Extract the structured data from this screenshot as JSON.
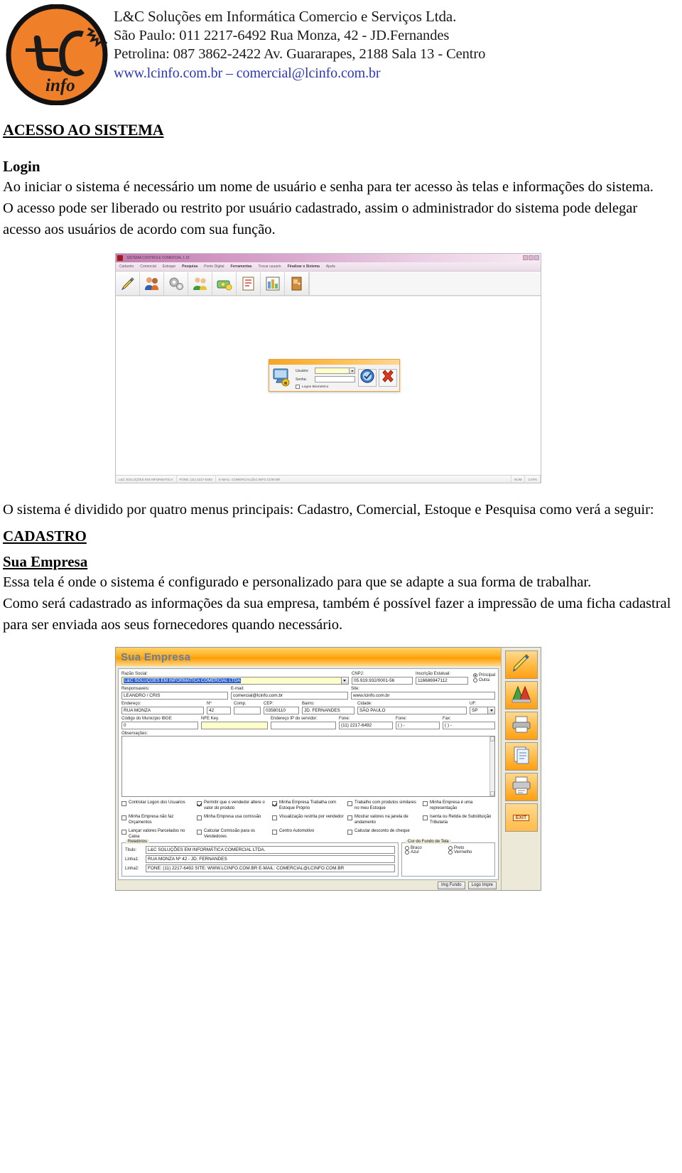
{
  "letterhead": {
    "logo_alt": "lc-info-logo",
    "logo_text_top": "L C",
    "logo_text_bottom": "info",
    "lines": [
      "L&C Soluções em Informática Comercio e Serviços Ltda.",
      "São Paulo: 011 2217-6492 Rua Monza, 42  -  JD.Fernandes",
      "Petrolina:   087 3862-2422 Av. Guararapes, 2188 Sala 13 - Centro"
    ],
    "url_line": "www.lcinfo.com.br – comercial@lcinfo.com.br"
  },
  "doc": {
    "section_title": "ACESSO AO SISTEMA",
    "login_heading": "Login",
    "login_p1": "Ao iniciar o sistema é necessário um nome de usuário e senha para ter acesso às telas e informações do sistema.",
    "login_p2": "O acesso pode ser liberado ou restrito por usuário cadastrado, assim o administrador do sistema pode delegar acesso aos usuários de acordo com sua função.",
    "menus_p": "O sistema é dividido por quatro menus principais: Cadastro, Comercial, Estoque e Pesquisa como verá a seguir:",
    "cadastro_title": "CADASTRO",
    "empresa_title": "Sua Empresa",
    "empresa_p1": "Essa tela é onde o sistema é configurado e personalizado para que se adapte a sua forma de trabalhar.",
    "empresa_p2": "Como será cadastrado as informações da sua empresa, também é possível fazer a impressão de uma ficha cadastral para ser enviada aos seus fornecedores quando necessário."
  },
  "screenshot_login": {
    "window_title": "SISTEMA CONTROLE COMERCIAL 1.19",
    "menus": [
      "Cadastro",
      "Comercial",
      "Estoque",
      "Pesquisa",
      "Ponto Digital",
      "Ferramentas",
      "Trocar usuario",
      "Finalizar o Sistema",
      "Ajuda"
    ],
    "toolbar_icons": [
      "pen-tool-icon",
      "users-icon",
      "gears-icon",
      "people-icon",
      "money-icon",
      "note-icon",
      "report-icon",
      "door-exit-icon"
    ],
    "dialog": {
      "user_label": "Usuário:",
      "user_value": "",
      "password_label": "Senha:",
      "password_value": "",
      "biometric_label": "Logon Biometrico",
      "ok_icon": "check-circle-icon",
      "cancel_icon": "red-x-icon"
    },
    "status_bar": [
      "L&C SOLUÇÕES EM INFORMATICA",
      "FONE: (11) 2217-6492",
      "E-MAIL: COMERCIAL@LCINFO.COM.BR",
      "NUM",
      "CAPS"
    ]
  },
  "screenshot_empresa": {
    "title": "Sua Empresa",
    "fields": {
      "razao_social_label": "Razão Social:",
      "razao_social_value": "L&C SOLUÇOES EM INFORMATICA COMERCIAL LTDA",
      "cnpj_label": "CNPJ:",
      "cnpj_value": "05.919.932/0001-56",
      "inscricao_label": "Inscrição Estatual:",
      "inscricao_value": "116686947112",
      "radio_principal": "Principal",
      "radio_outra": "Outra",
      "responsaveis_label": "Responsaveis:",
      "responsaveis_value": "LEANDRO / CRIS",
      "email_label": "E-mail:",
      "email_value": "comercial@lcinfo.com.br",
      "site_label": "Site:",
      "site_value": "www.lcinfo.com.br",
      "endereco_label": "Endereço:",
      "endereco_value": "RUA MONZA",
      "numero_label": "Nº",
      "numero_value": "42",
      "comp_label": "Comp.",
      "comp_value": "",
      "cep_label": "CEP:",
      "cep_value": "03580110",
      "bairro_label": "Bairro:",
      "bairro_value": "JD. FERNANDES",
      "cidade_label": "Cidade:",
      "cidade_value": "SÃO PAULO",
      "uf_label": "UF:",
      "uf_value": "SP",
      "municipio_label": "Código do Município IBGE",
      "municipio_value": "0",
      "nfe_label": "NFE Key.",
      "nfe_value": "",
      "ip_label": "Endereço IP do servidor:",
      "ip_value": "",
      "fone_label": "Fone:",
      "fone_value": "(11) 2217-6492",
      "fone2_label": "Fone:",
      "fone2_value": "(  )   -",
      "fax_label": "Fax:",
      "fax_value": "(  )   -",
      "obs_label": "Observações:",
      "obs_value": ""
    },
    "checkboxes": [
      {
        "label": "Controlar Logon dos Usuarios",
        "checked": false
      },
      {
        "label": "Permitir que o vendedor altere o valor do produto",
        "checked": true
      },
      {
        "label": "Minha Empresa Trabalha com Estoque Próprio",
        "checked": true
      },
      {
        "label": "Trabalho com produtos similares no meu Estoque",
        "checked": false
      },
      {
        "label": "Minha Empresa é uma representação",
        "checked": false
      },
      {
        "label": "Minha Empresa não faz Orçamentos",
        "checked": false
      },
      {
        "label": "Minha Empresa usa comissão",
        "checked": false
      },
      {
        "label": "Visualização restrita por vendedor",
        "checked": false
      },
      {
        "label": "Mostrar valores na janela de andamento",
        "checked": false
      },
      {
        "label": "Isenta ou Retida de Substituição Tributaria",
        "checked": false
      },
      {
        "label": "Lançar valores Parcelados no Caixa",
        "checked": false
      },
      {
        "label": "Calcular Comissão para os Vendedores",
        "checked": false
      },
      {
        "label": "Centro Automotivo",
        "checked": false
      },
      {
        "label": "Calcular desconto de cheque",
        "checked": false
      }
    ],
    "relatorios": {
      "group_label": "Relatórios",
      "titulo_label": "Titulo:",
      "titulo_value": "L&C SOLUÇÕES EM INFORMÁTICA COMERCIAL LTDA.",
      "linha1_label": "Linha1:",
      "linha1_value": "RUA MONZA Nº 42 - JD. FERNANDES",
      "linha2_label": "Linha2:",
      "linha2_value": "FONE: (11) 2217-6492 SITE: WWW.LCINFO.COM.BR E-MAIL: COMERCIAL@LCINFO.COM.BR"
    },
    "cor_fundo": {
      "group_label": "Cor do Fundo de Tela",
      "options": [
        {
          "label": "Braco",
          "selected": false
        },
        {
          "label": "Preto",
          "selected": false
        },
        {
          "label": "Azul",
          "selected": false
        },
        {
          "label": "Vermelho",
          "selected": false
        }
      ]
    },
    "bottom_buttons": [
      "Img Fundo",
      "Logo Impre"
    ],
    "side_buttons": [
      "edit-pencil-icon",
      "colors-palette-icon",
      "printer-icon",
      "documents-icon",
      "print-preview-icon",
      "exit-door-icon"
    ],
    "exit_label": "EXIT"
  },
  "colors": {
    "link": "#2b36b4",
    "logo_orange": "#ef7f28",
    "title_orange": "#ff9c00",
    "title_blue": "#5b7fb0",
    "selection_blue": "#2a5fd8"
  }
}
